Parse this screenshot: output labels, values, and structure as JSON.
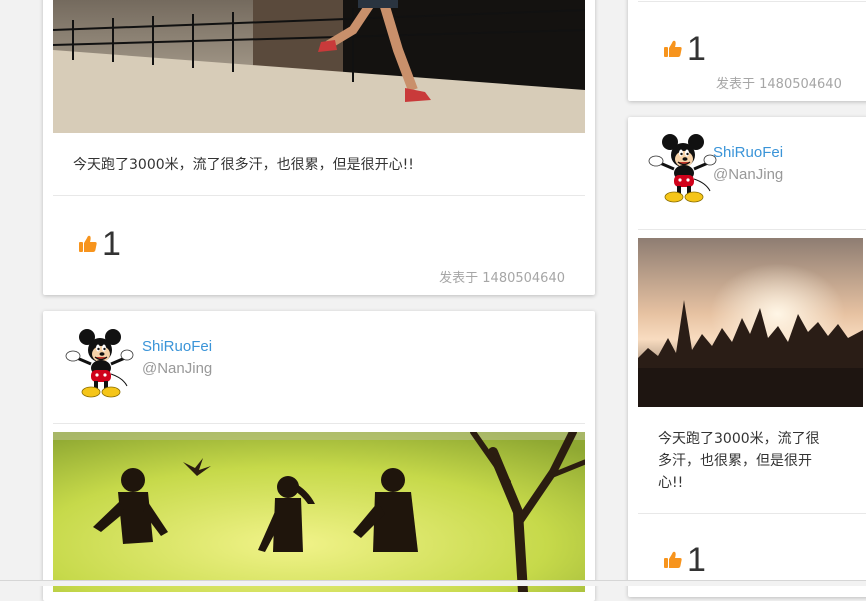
{
  "feed": {
    "left": {
      "post1": {
        "content": "今天跑了3000米，流了很多汗，也很累，但是很开心!!",
        "likes": "1",
        "time": "发表于 1480504640"
      },
      "post2": {
        "user_name": "ShiRuoFei",
        "user_location": "@NanJing"
      }
    },
    "right": {
      "post1": {
        "likes": "1",
        "time": "发表于 1480504640"
      },
      "post2": {
        "user_name": "ShiRuoFei",
        "user_location": "@NanJing",
        "content_lines": [
          "今天跑了3000米，流了很",
          "多汗，也很累，但是很开",
          "心!!"
        ],
        "likes": "1"
      }
    }
  },
  "colors": {
    "like_icon": "#f7941d",
    "username": "#3a94d8",
    "muted": "#a6a6a6"
  },
  "icons": {
    "like": "thumbs-up-icon",
    "avatar": "mickey-mouse-avatar"
  }
}
